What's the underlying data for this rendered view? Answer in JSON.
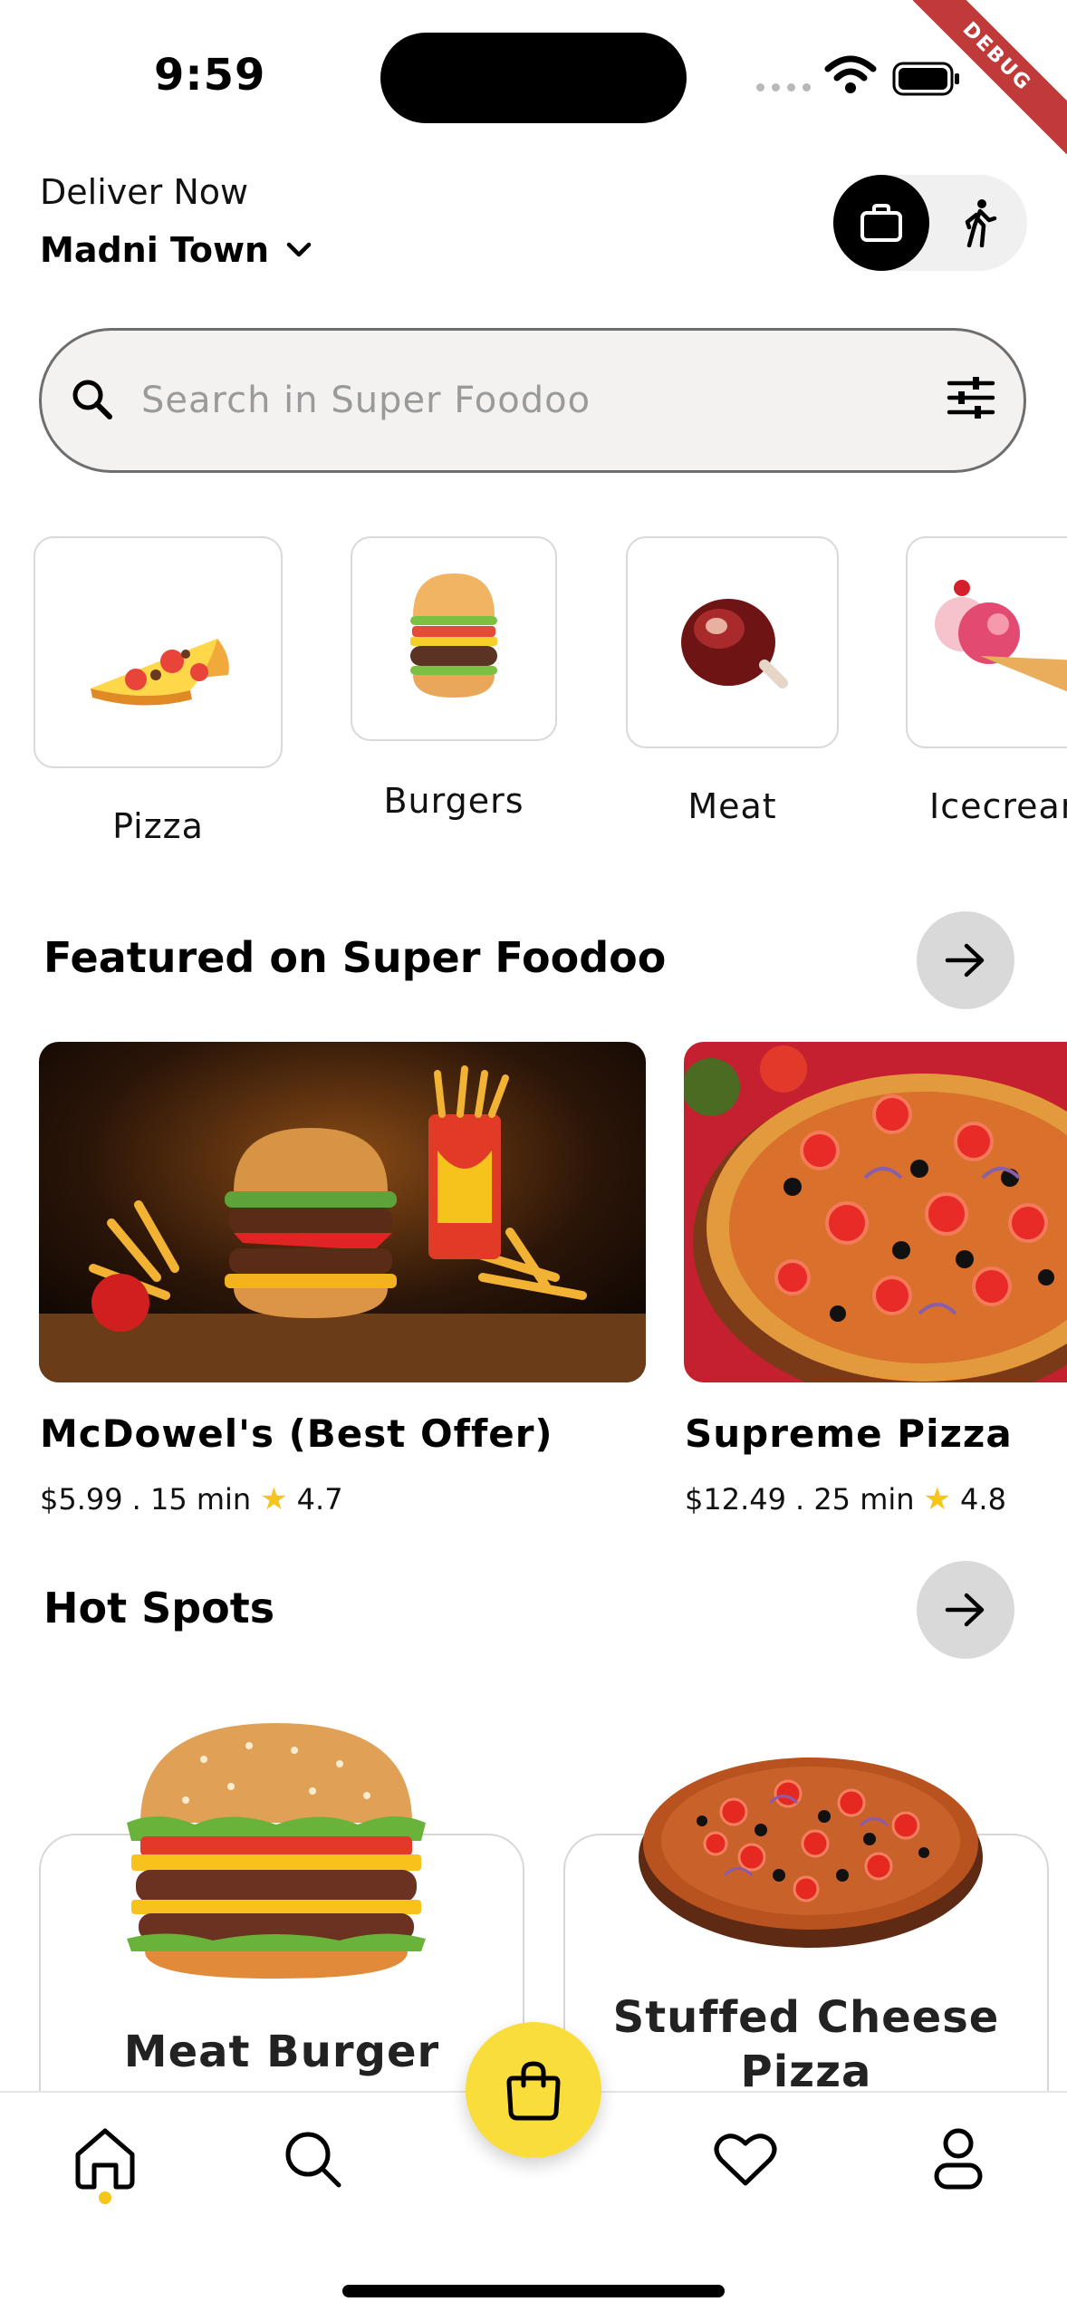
{
  "status": {
    "time": "9:59",
    "debug_label": "DEBUG"
  },
  "header": {
    "deliver_label": "Deliver Now",
    "location": "Madni Town"
  },
  "search": {
    "placeholder": "Search in Super Foodoo"
  },
  "categories": [
    {
      "label": "Pizza",
      "icon": "pizza-slice-icon"
    },
    {
      "label": "Burgers",
      "icon": "burger-icon"
    },
    {
      "label": "Meat",
      "icon": "meat-icon"
    },
    {
      "label": "Icecrean",
      "icon": "icecream-icon"
    }
  ],
  "featured": {
    "title": "Featured on Super Foodoo",
    "items": [
      {
        "name": "McDowel's (Best Offer)",
        "price": "$5.99",
        "time": ". 15 min",
        "rating": "4.7"
      },
      {
        "name": "Supreme Pizza",
        "price": "$12.49",
        "time": ". 25 min",
        "rating": "4.8"
      }
    ]
  },
  "hot_spots": {
    "title": "Hot Spots",
    "items": [
      {
        "name": "Meat Burger"
      },
      {
        "name": "Stuffed Cheese Pizza"
      }
    ]
  },
  "nav": {
    "items": [
      "home-icon",
      "search-icon",
      "shopping-bag-icon",
      "heart-icon",
      "profile-icon"
    ]
  },
  "colors": {
    "accent": "#f9dd3b",
    "star": "#f5c518",
    "debug": "#c13a3a"
  }
}
